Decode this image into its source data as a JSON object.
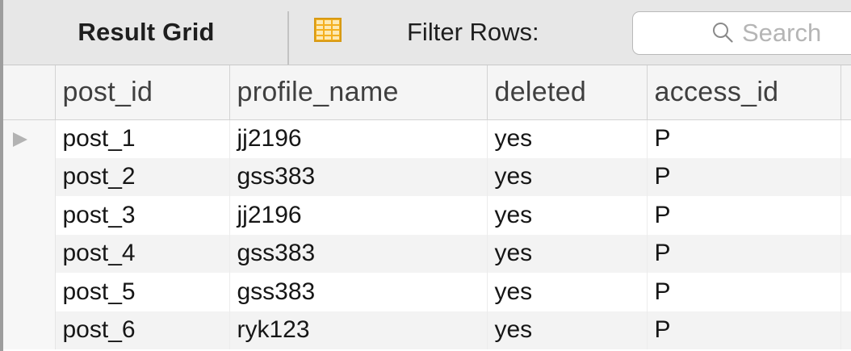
{
  "toolbar": {
    "tab_label": "Result Grid",
    "filter_label": "Filter Rows:",
    "search_placeholder": "Search"
  },
  "table": {
    "columns": [
      "post_id",
      "profile_name",
      "deleted",
      "access_id"
    ],
    "rows": [
      [
        "post_1",
        "jj2196",
        "yes",
        "P"
      ],
      [
        "post_2",
        "gss383",
        "yes",
        "P"
      ],
      [
        "post_3",
        "jj2196",
        "yes",
        "P"
      ],
      [
        "post_4",
        "gss383",
        "yes",
        "P"
      ],
      [
        "post_5",
        "gss383",
        "yes",
        "P"
      ],
      [
        "post_6",
        "ryk123",
        "yes",
        "P"
      ]
    ],
    "current_row_index": 0
  },
  "icons": {
    "grid_toggle": "grid-view-icon",
    "search": "search-icon",
    "row_pointer": "current-row-pointer-icon"
  },
  "colors": {
    "grid_icon_fill": "#f4b01f",
    "toolbar_bg": "#e7e7e7",
    "header_bg": "#f5f5f5",
    "alt_row_bg": "#f3f3f3"
  }
}
